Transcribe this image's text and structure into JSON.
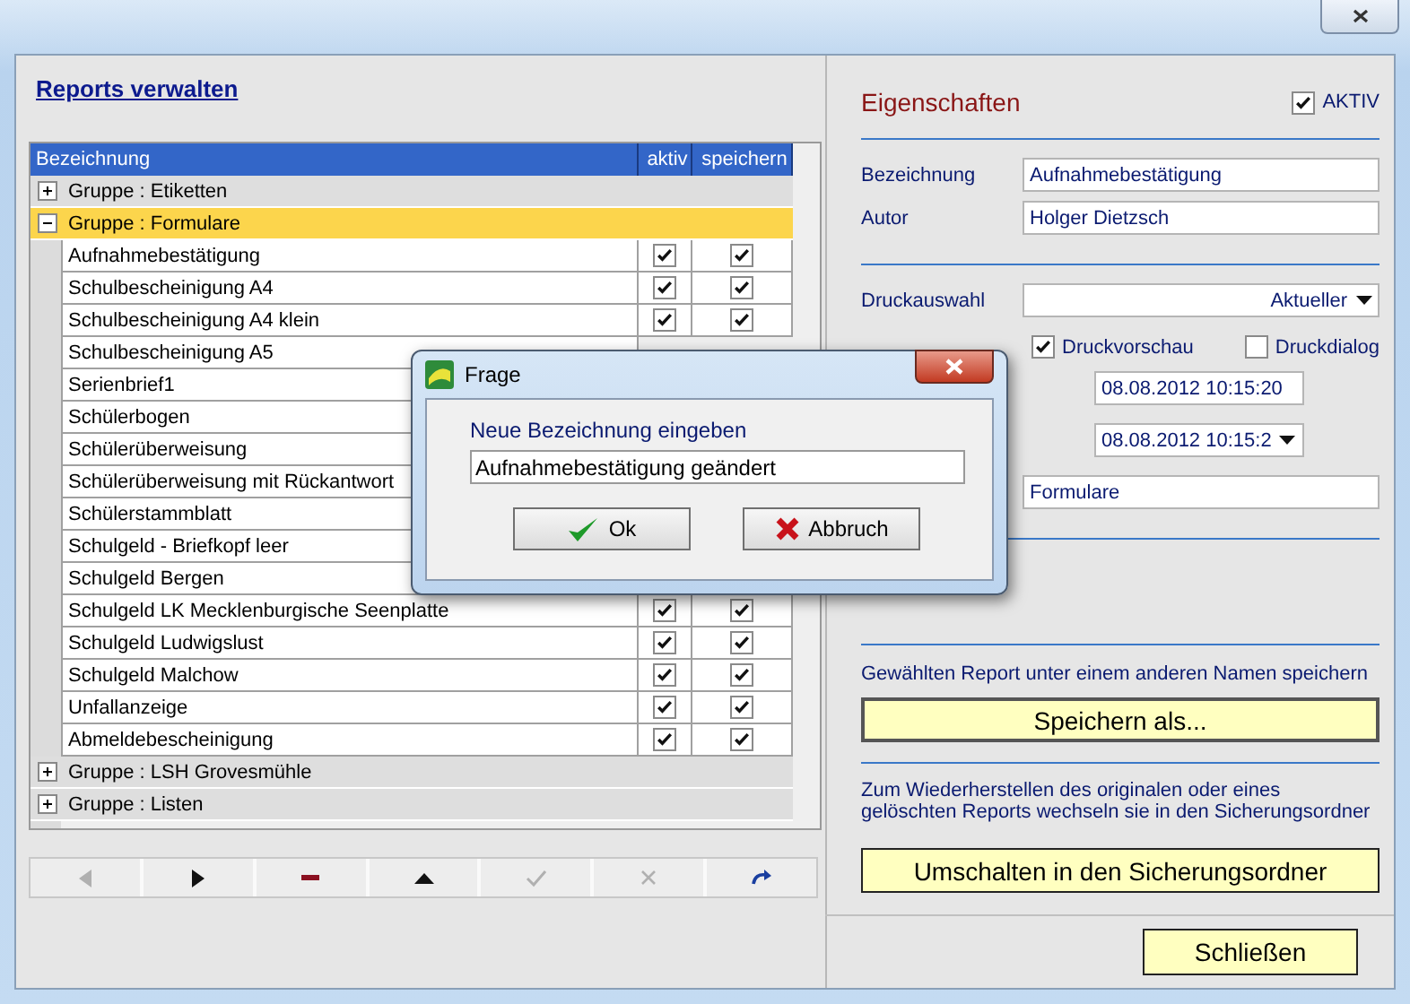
{
  "left": {
    "title": "Reports verwalten",
    "table": {
      "columns": [
        "Bezeichnung",
        "aktiv",
        "speichern"
      ],
      "rows": [
        {
          "kind": "group",
          "label": "Gruppe : Etiketten",
          "expanded": false,
          "selected": false
        },
        {
          "kind": "group",
          "label": "Gruppe : Formulare",
          "expanded": true,
          "selected": true,
          "children": [
            {
              "label": "Aufnahmebestätigung",
              "aktiv": true,
              "speichern": true
            },
            {
              "label": "Schulbescheinigung A4",
              "aktiv": true,
              "speichern": true
            },
            {
              "label": "Schulbescheinigung A4 klein",
              "aktiv": true,
              "speichern": true
            },
            {
              "label": "Schulbescheinigung A5"
            },
            {
              "label": "Serienbrief1"
            },
            {
              "label": "Schülerbogen"
            },
            {
              "label": "Schülerüberweisung"
            },
            {
              "label": "Schülerüberweisung mit Rückantwort"
            },
            {
              "label": "Schülerstammblatt"
            },
            {
              "label": "Schulgeld - Briefkopf leer"
            },
            {
              "label": "Schulgeld Bergen"
            },
            {
              "label": "Schulgeld LK Mecklenburgische Seenplatte",
              "aktiv": true,
              "speichern": true
            },
            {
              "label": "Schulgeld Ludwigslust",
              "aktiv": true,
              "speichern": true
            },
            {
              "label": "Schulgeld Malchow",
              "aktiv": true,
              "speichern": true
            },
            {
              "label": "Unfallanzeige",
              "aktiv": true,
              "speichern": true
            },
            {
              "label": "Abmeldebescheinigung",
              "aktiv": true,
              "speichern": true
            }
          ]
        },
        {
          "kind": "group",
          "label": "Gruppe : LSH Grovesmühle",
          "expanded": false,
          "selected": false
        },
        {
          "kind": "group",
          "label": "Gruppe : Listen",
          "expanded": false,
          "selected": false
        }
      ]
    },
    "toolbar": [
      {
        "kind": "previous",
        "disabled": true
      },
      {
        "kind": "next",
        "disabled": false
      },
      {
        "kind": "delete",
        "disabled": false
      },
      {
        "kind": "up",
        "disabled": false
      },
      {
        "kind": "confirm",
        "disabled": true
      },
      {
        "kind": "cancel",
        "disabled": true
      },
      {
        "kind": "redo",
        "disabled": false
      }
    ]
  },
  "right": {
    "title": "Eigenschaften",
    "aktiv": {
      "label": "AKTIV",
      "checked": true
    },
    "fields": [
      {
        "label": "Bezeichnung",
        "value": "Aufnahmebestätigung"
      },
      {
        "label": "Autor",
        "value": "Holger Dietzsch"
      }
    ],
    "druckauswahl": {
      "label": "Druckauswahl",
      "value": "Aktueller"
    },
    "options": [
      {
        "label": "Druckvorschau",
        "checked": true
      },
      {
        "label": "Druckdialog",
        "checked": false
      }
    ],
    "date_field": "08.08.2012 10:15:20",
    "date_dropdown": "08.08.2012 10:15:2",
    "group_field": "Formulare",
    "save_as": {
      "hint": "Gewählten Report unter einem anderen Namen speichern",
      "button": "Speichern als..."
    },
    "backup": {
      "hint": "Zum Wiederherstellen des originalen oder eines gelöschten Reports wechseln sie in den Sicherungsordner",
      "button": "Umschalten in den Sicherungsordner"
    },
    "close_button": "Schließen"
  },
  "dialog": {
    "title": "Frage",
    "prompt": "Neue Bezeichnung eingeben",
    "value": "Aufnahmebestätigung geändert",
    "buttons": [
      {
        "kind": "ok",
        "label": "Ok"
      },
      {
        "kind": "cancel",
        "label": "Abbruch"
      }
    ]
  }
}
